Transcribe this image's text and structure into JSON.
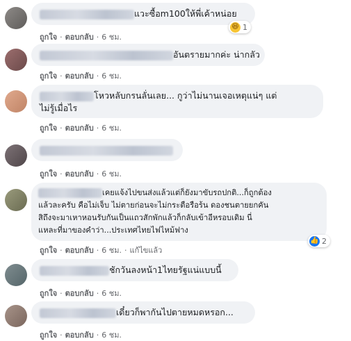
{
  "comments": [
    {
      "lines": [
        "แวะซื้อm100ให้พี่เค้าหน่อย"
      ],
      "like": "ถูกใจ",
      "reply": "ตอบกลับ",
      "time": "6 ชม.",
      "reaction": {
        "icon": "haha-emoji-icon",
        "count": "1"
      }
    },
    {
      "lines": [
        "อันตรายมากค่ะ น่ากลัว"
      ],
      "like": "ถูกใจ",
      "reply": "ตอบกลับ",
      "time": "6 ชม."
    },
    {
      "lines": [
        "โหวหลับกรนลั่นเลย... กูว่าไม่นานเจอเหตุแน่ๆ แต่",
        "ไม่รู้เมื่อไร"
      ],
      "like": "ถูกใจ",
      "reply": "ตอบกลับ",
      "time": "6 ชม."
    },
    {
      "lines": [
        ""
      ],
      "like": "ถูกใจ",
      "reply": "ตอบกลับ",
      "time": "6 ชม."
    },
    {
      "lines": [
        "เคยแจ้งไปขนส่งแล้วแต่ก็ยังมาขับรถปกติ...ก็ถูกต้อง",
        "แล้วละครับ คือไม่เจ็บ ไม่ตายก่อนจะไม่กระตือรือร้น ดองชนตายยกคัน",
        "สิถึงจะมาเหาหอนรับกันเป็นแถวสักพักแล้วก็กลับเข้าอีหรอบเดิม นี่",
        "แหละที่มาของคำว่า...ประเทศไทยไฟไหม้ฟาง"
      ],
      "like": "ถูกใจ",
      "reply": "ตอบกลับ",
      "time": "6 ชม.",
      "edited": "แก้ไขแล้ว",
      "reaction": {
        "icon": "like-thumb-icon",
        "count": "2"
      }
    },
    {
      "lines": [
        "ชักวันลงหน้า1ไทยรัฐแน่แบบนี้"
      ],
      "like": "ถูกใจ",
      "reply": "ตอบกลับ",
      "time": "6 ชม."
    },
    {
      "lines": [
        "เดี๋ยวก็พากันไปตายหมดหรอก..."
      ],
      "like": "ถูกใจ",
      "reply": "ตอบกลับ",
      "time": "6 ชม."
    }
  ],
  "colors": {
    "bubble": "#f0f2f5",
    "text": "#1c1e21",
    "meta": "#65676b",
    "like_blue": "#1877f2",
    "haha_yellow": "#f7c433"
  }
}
